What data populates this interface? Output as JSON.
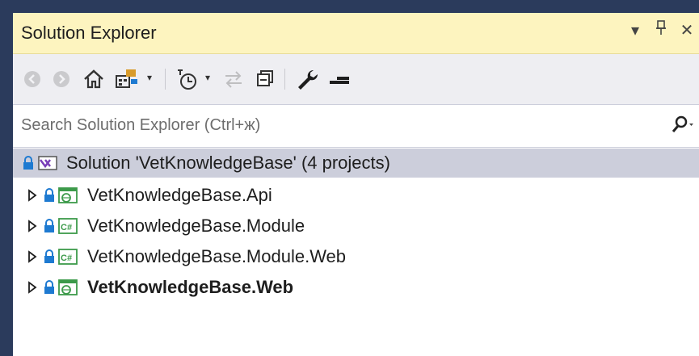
{
  "panel": {
    "title": "Solution Explorer",
    "title_actions": [
      {
        "name": "window-position-dropdown",
        "glyph": "▾"
      },
      {
        "name": "auto-hide-pin",
        "glyph": "⊥"
      },
      {
        "name": "close-panel",
        "glyph": "✕"
      }
    ]
  },
  "toolbar": {
    "buttons": [
      {
        "name": "back-button",
        "icon": "back-arrow-icon",
        "enabled": false
      },
      {
        "name": "forward-button",
        "icon": "forward-arrow-icon",
        "enabled": false
      },
      {
        "name": "home-button",
        "icon": "home-icon",
        "enabled": true
      },
      {
        "name": "switch-views-button",
        "icon": "switch-views-icon",
        "enabled": true,
        "dropdown": true
      },
      {
        "name": "pending-changes-filter-button",
        "icon": "clock-filter-icon",
        "enabled": true,
        "dropdown": true
      },
      {
        "name": "sync-with-active-document-button",
        "icon": "sync-icon",
        "enabled": false
      },
      {
        "name": "collapse-all-button",
        "icon": "collapse-all-icon",
        "enabled": true
      },
      {
        "name": "properties-button",
        "icon": "wrench-icon",
        "enabled": true
      },
      {
        "name": "preview-selected-items-button",
        "icon": "minus-bar-icon",
        "enabled": true
      }
    ]
  },
  "search": {
    "placeholder": "Search Solution Explorer (Ctrl+ж)",
    "value": "",
    "icon": "search-icon",
    "dropdown_glyph": "⌕"
  },
  "tree": {
    "solution": {
      "label": "Solution 'VetKnowledgeBase' (4 projects)",
      "icon": "solution-icon",
      "selected": true
    },
    "projects": [
      {
        "label": "VetKnowledgeBase.Api",
        "icon": "web-project-icon",
        "bold": false
      },
      {
        "label": "VetKnowledgeBase.Module",
        "icon": "csharp-project-icon",
        "bold": false
      },
      {
        "label": "VetKnowledgeBase.Module.Web",
        "icon": "csharp-project-icon",
        "bold": false
      },
      {
        "label": "VetKnowledgeBase.Web",
        "icon": "web-project-icon",
        "bold": true
      }
    ]
  },
  "colors": {
    "title_bg": "#fdf4bf",
    "toolbar_bg": "#eeeef2",
    "selection_bg": "#cccedb",
    "frame": "#2b3b5c",
    "lock_blue": "#1e7ad1",
    "project_green": "#3c9a4a"
  }
}
